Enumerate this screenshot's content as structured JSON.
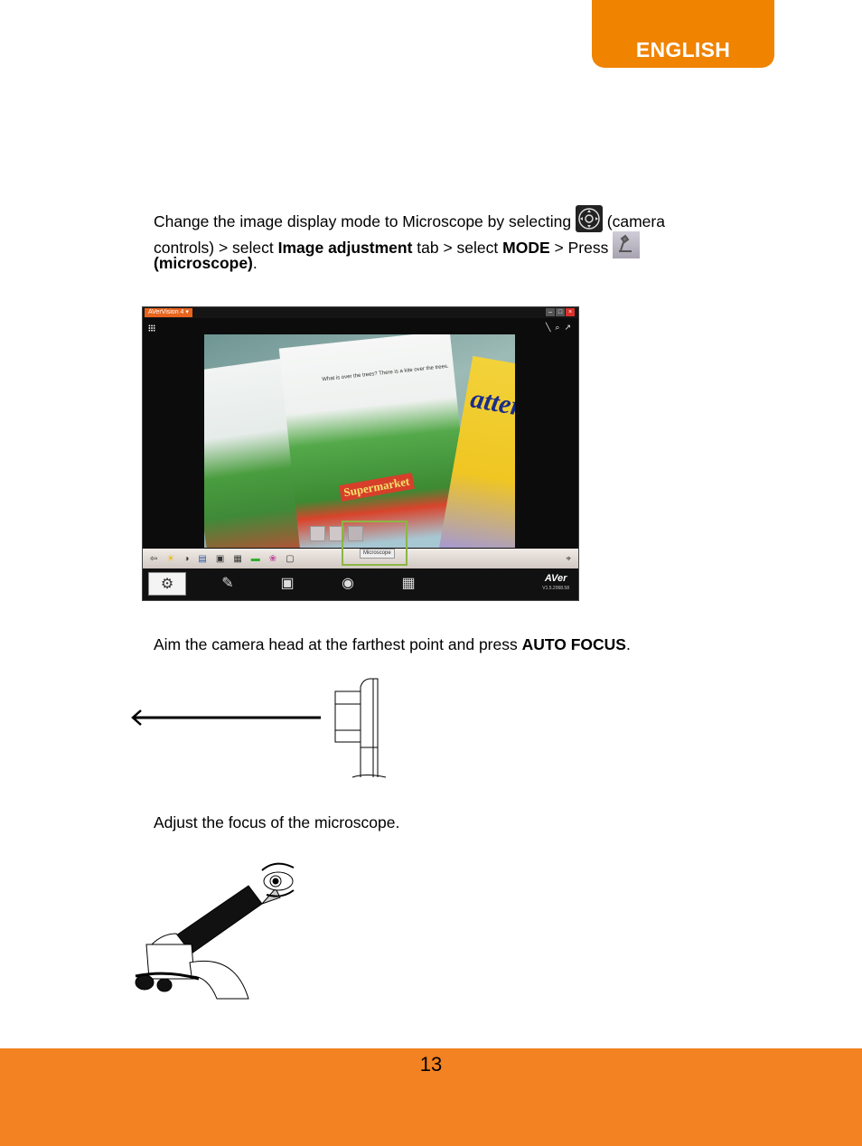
{
  "header": {
    "language_tab": "ENGLISH"
  },
  "step1": {
    "text_a": "Change the image display mode to Microscope by selecting ",
    "icon_a": "camera-controls-icon",
    "text_b": "(camera",
    "text_c": "controls)  > select ",
    "bold_1": "Image adjustment",
    "text_d": " tab  > select ",
    "bold_2": "MODE",
    "text_e": "  > Press ",
    "icon_b": "microscope-icon",
    "bold_3": "(microscope)",
    "text_f": "."
  },
  "screenshot": {
    "app_title": "AVerVision 4  ▾",
    "window_buttons": [
      "–",
      "□",
      "×"
    ],
    "top_tools": [
      "╲",
      "⌕",
      "↗"
    ],
    "book": {
      "title": "attern",
      "sign": "Supermarket",
      "caption": "What is over the trees? There is a kite over the trees."
    },
    "tooltip": "Microscope",
    "toolbar_icons": [
      "⇦",
      "☀",
      "◑",
      "▤",
      "▣",
      "▦",
      "▬",
      "❀",
      "▢"
    ],
    "pin_icon": "⌖",
    "bottom_buttons": [
      "⚙",
      "✎",
      "▣",
      "◉",
      "▦"
    ],
    "logo": "AVer",
    "version": "V1.5.2068.58"
  },
  "step2": {
    "text_a": "Aim the camera head at the farthest point and press ",
    "bold": "AUTO FOCUS",
    "text_b": "."
  },
  "step3": {
    "text": "Adjust the focus of the microscope."
  },
  "footer": {
    "page_number": "13"
  },
  "colors": {
    "tab_orange": "#f08300",
    "footer_orange": "#f28222",
    "highlight_green": "#8db643"
  }
}
